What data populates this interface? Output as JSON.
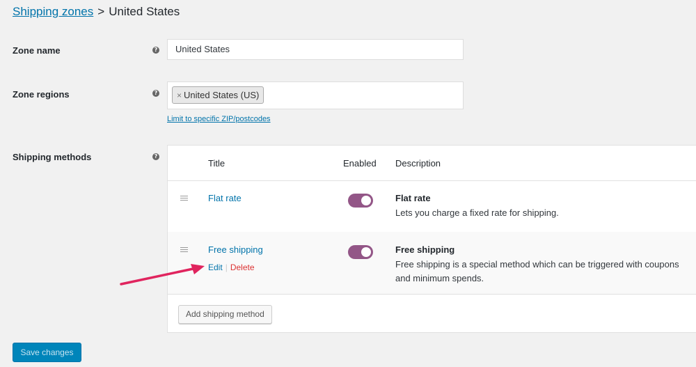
{
  "breadcrumb": {
    "parent": "Shipping zones",
    "separator": ">",
    "current": "United States"
  },
  "zone_name": {
    "label": "Zone name",
    "value": "United States"
  },
  "zone_regions": {
    "label": "Zone regions",
    "chip_remove": "×",
    "chip_label": "United States (US)",
    "limit_link": "Limit to specific ZIP/postcodes"
  },
  "shipping_methods": {
    "label": "Shipping methods",
    "columns": {
      "title": "Title",
      "enabled": "Enabled",
      "description": "Description"
    },
    "rows": [
      {
        "title": "Flat rate",
        "enabled": true,
        "desc_title": "Flat rate",
        "desc_text": "Lets you charge a fixed rate for shipping."
      },
      {
        "title": "Free shipping",
        "enabled": true,
        "desc_title": "Free shipping",
        "desc_text": "Free shipping is a special method which can be triggered with coupons and minimum spends.",
        "actions": {
          "edit": "Edit",
          "separator": "|",
          "delete": "Delete"
        }
      }
    ],
    "add_button": "Add shipping method"
  },
  "help_glyph": "?",
  "save_button": "Save changes",
  "colors": {
    "link": "#0073aa",
    "toggle_on": "#935687",
    "delete": "#dc3232",
    "primary_button": "#0085ba",
    "annotation_arrow": "#e0245e"
  },
  "icons": [
    "help-icon",
    "drag-handle-icon",
    "toggle-switch-icon",
    "annotation-arrow-icon"
  ]
}
